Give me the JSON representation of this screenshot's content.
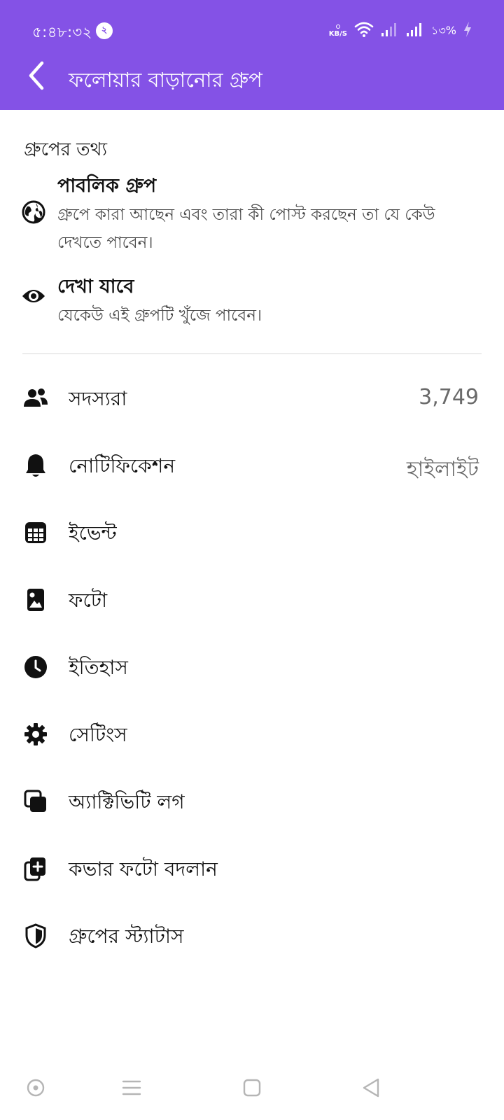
{
  "status_bar": {
    "time": "৫:৪৮:৩২",
    "notification_count": "২",
    "speed_unit": "KB/S",
    "battery": "১৩%"
  },
  "header": {
    "title": "ফলোয়ার বাড়ানোর গ্রুপ",
    "background_color": "#8452e6"
  },
  "group_info": {
    "section_title": "গ্রুপের তথ্য",
    "items": [
      {
        "icon": "globe-icon",
        "title": "পাবলিক গ্রুপ",
        "description": "গ্রুপে কারা আছেন এবং তারা কী পোস্ট করছেন তা যে কেউ দেখতে পাবেন।"
      },
      {
        "icon": "eye-icon",
        "title": "দেখা যাবে",
        "description": "যেকেউ এই গ্রুপটি খুঁজে পাবেন।"
      }
    ]
  },
  "menu": {
    "items": [
      {
        "icon": "members-icon",
        "label": "সদস্যরা",
        "value": "3,749"
      },
      {
        "icon": "bell-icon",
        "label": "নোটিফিকেশন",
        "value": "হাইলাইট"
      },
      {
        "icon": "calendar-icon",
        "label": "ইভেন্ট",
        "value": ""
      },
      {
        "icon": "photo-icon",
        "label": "ফটো",
        "value": ""
      },
      {
        "icon": "clock-icon",
        "label": "ইতিহাস",
        "value": ""
      },
      {
        "icon": "gear-icon",
        "label": "সেটিংস",
        "value": ""
      },
      {
        "icon": "activity-log-icon",
        "label": "অ্যাক্টিভিটি লগ",
        "value": ""
      },
      {
        "icon": "add-cover-photo-icon",
        "label": "কভার ফটো বদলান",
        "value": ""
      },
      {
        "icon": "shield-icon",
        "label": "গ্রুপের স্ট্যাটাস",
        "value": ""
      }
    ]
  },
  "navbar": {
    "buttons": [
      "assistant-icon",
      "menu-icon",
      "home-icon",
      "back-icon"
    ]
  }
}
